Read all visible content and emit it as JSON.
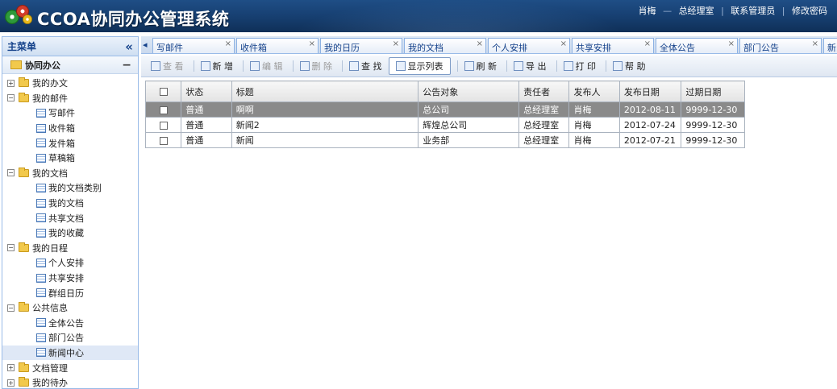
{
  "header": {
    "title": "CCOA协同办公管理系统",
    "user": "肖梅",
    "dash": "—",
    "role": "总经理室",
    "links": [
      "联系管理员",
      "修改密码"
    ],
    "sep": "|"
  },
  "sidebar": {
    "title": "主菜单",
    "collapse_glyph": "«",
    "section": "协同办公",
    "section_toggle": "−",
    "tree": [
      {
        "type": "folder",
        "toggle": "+",
        "label": "我的办文"
      },
      {
        "type": "folder",
        "toggle": "−",
        "label": "我的邮件"
      },
      {
        "type": "leaf",
        "label": "写邮件"
      },
      {
        "type": "leaf",
        "label": "收件箱"
      },
      {
        "type": "leaf",
        "label": "发件箱"
      },
      {
        "type": "leaf",
        "label": "草稿箱"
      },
      {
        "type": "folder",
        "toggle": "−",
        "label": "我的文档"
      },
      {
        "type": "leaf",
        "label": "我的文档类别"
      },
      {
        "type": "leaf",
        "label": "我的文档"
      },
      {
        "type": "leaf",
        "label": "共享文档"
      },
      {
        "type": "leaf",
        "label": "我的收藏"
      },
      {
        "type": "folder",
        "toggle": "−",
        "label": "我的日程"
      },
      {
        "type": "leaf",
        "label": "个人安排"
      },
      {
        "type": "leaf",
        "label": "共享安排"
      },
      {
        "type": "leaf",
        "label": "群组日历"
      },
      {
        "type": "folder",
        "toggle": "−",
        "label": "公共信息"
      },
      {
        "type": "leaf",
        "label": "全体公告"
      },
      {
        "type": "leaf",
        "label": "部门公告"
      },
      {
        "type": "leaf",
        "label": "新闻中心",
        "selected": true
      },
      {
        "type": "folder",
        "toggle": "+",
        "label": "文档管理"
      },
      {
        "type": "folder",
        "toggle": "+",
        "label": "我的待办"
      }
    ]
  },
  "tabs": {
    "scroll_glyph": "◂",
    "close_glyph": "×",
    "items": [
      "写邮件",
      "收件箱",
      "我的日历",
      "我的文档",
      "个人安排",
      "共享安排",
      "全体公告",
      "部门公告",
      "新闻"
    ]
  },
  "toolbar": {
    "buttons": [
      {
        "label": "查 看",
        "disabled": true
      },
      {
        "label": "新 增"
      },
      {
        "label": "编 辑",
        "disabled": true
      },
      {
        "label": "删 除",
        "disabled": true
      },
      {
        "label": "查 找"
      },
      {
        "label": "显示列表",
        "active": true
      },
      {
        "label": "刷 新"
      },
      {
        "label": "导 出"
      },
      {
        "label": "打 印"
      },
      {
        "label": "帮 助"
      }
    ]
  },
  "grid": {
    "columns": [
      "状态",
      "标题",
      "公告对象",
      "责任者",
      "发布人",
      "发布日期",
      "过期日期"
    ],
    "rows": [
      {
        "cells": [
          "普通",
          "啊啊",
          "总公司",
          "总经理室",
          "肖梅",
          "2012-08-11",
          "9999-12-30"
        ],
        "selected": true
      },
      {
        "cells": [
          "普通",
          "新闻2",
          "辉煌总公司",
          "总经理室",
          "肖梅",
          "2012-07-24",
          "9999-12-30"
        ]
      },
      {
        "cells": [
          "普通",
          "新闻",
          "业务部",
          "总经理室",
          "肖梅",
          "2012-07-21",
          "9999-12-30"
        ]
      }
    ]
  }
}
